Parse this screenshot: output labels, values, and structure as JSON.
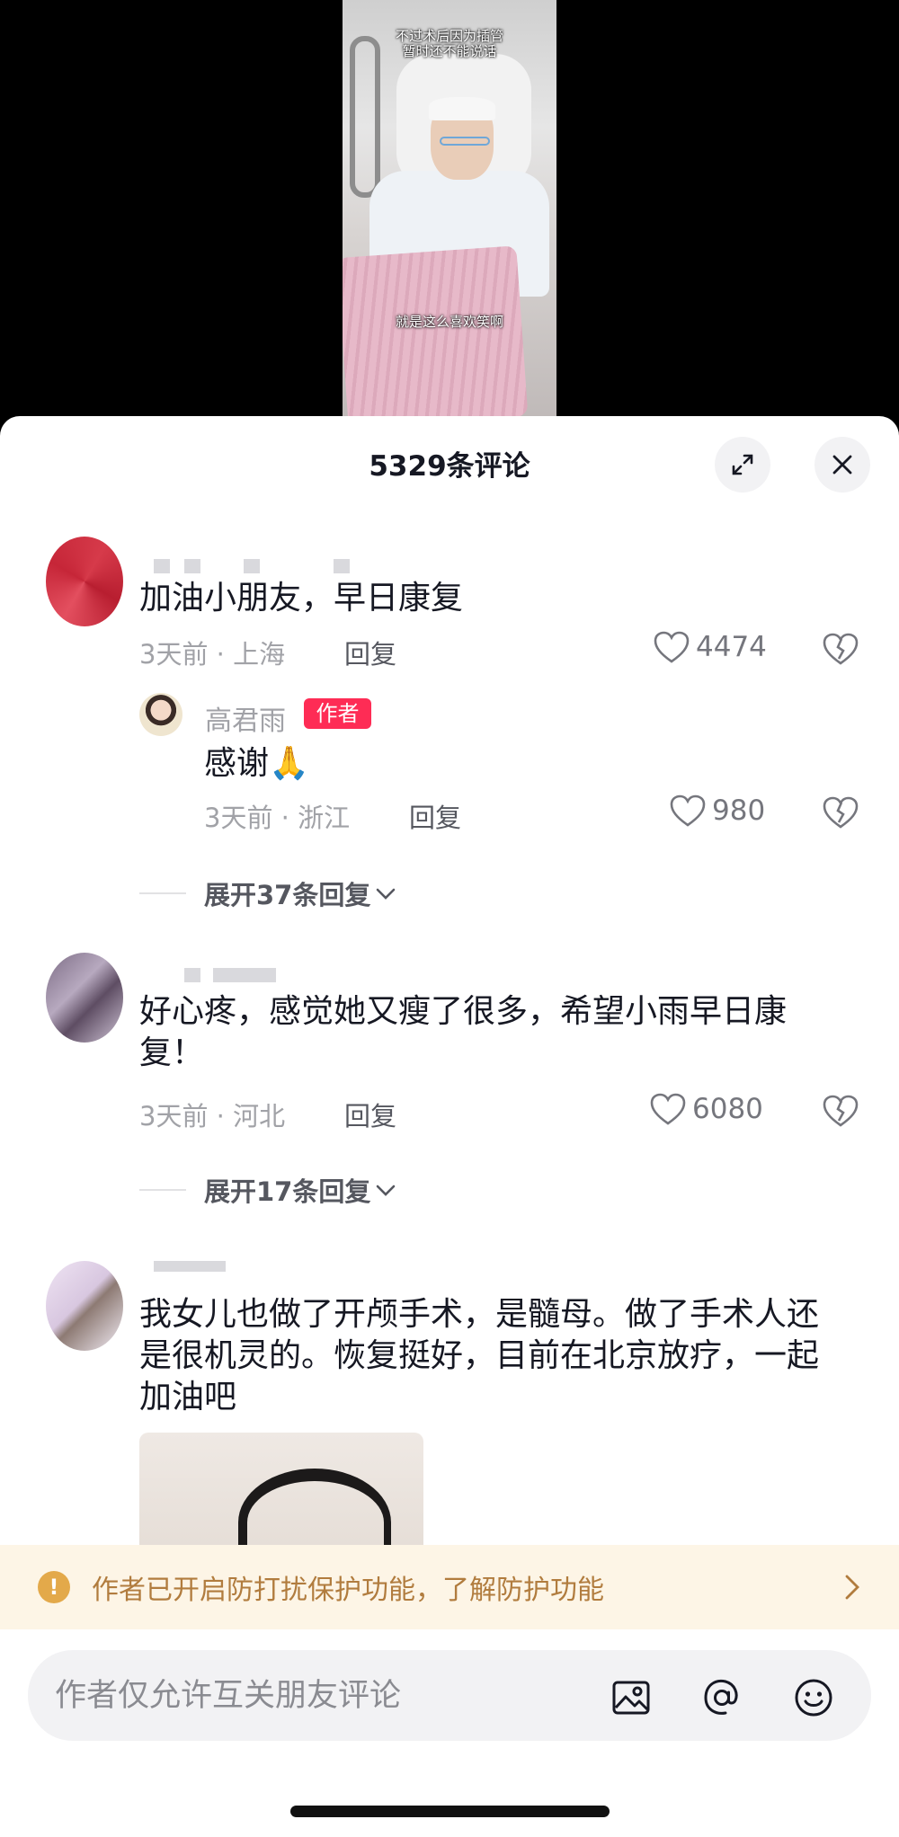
{
  "video": {
    "caption_top_line1": "不过术后因为插管",
    "caption_top_line2": "暂时还不能说话",
    "caption_bottom": "就是这么喜欢笑啊"
  },
  "panel": {
    "title": "5329条评论",
    "expand_icon": "expand-icon",
    "close_icon": "close-icon"
  },
  "comments": [
    {
      "text": "加油小朋友，早日康复",
      "meta": "3天前 · 上海",
      "reply_label": "回复",
      "likes": "4474",
      "author_reply": {
        "name": "高君雨",
        "badge": "作者",
        "text": "感谢🙏",
        "meta": "3天前 · 浙江",
        "reply_label": "回复",
        "likes": "980"
      },
      "expand_label": "展开37条回复"
    },
    {
      "text": "好心疼，感觉她又瘦了很多，希望小雨早日康复！",
      "meta": "3天前 · 河北",
      "reply_label": "回复",
      "likes": "6080",
      "expand_label": "展开17条回复"
    },
    {
      "text": "我女儿也做了开颅手术，是髓母。做了手术人还是很机灵的。恢复挺好，目前在北京放疗，一起加油吧"
    }
  ],
  "notice": {
    "text": "作者已开启防打扰保护功能，了解防护功能"
  },
  "input": {
    "placeholder": "作者仅允许互关朋友评论"
  },
  "colors": {
    "accent": "#fe2c55",
    "notice_bg": "#fdf5e6",
    "notice_text": "#b17c3e"
  }
}
